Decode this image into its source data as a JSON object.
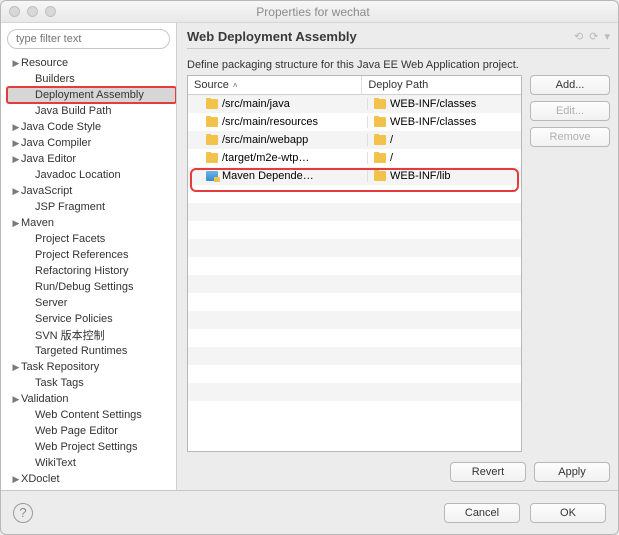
{
  "window": {
    "title": "Properties for wechat"
  },
  "filter": {
    "placeholder": "type filter text"
  },
  "tree": [
    {
      "label": "Resource",
      "expandable": true,
      "indent": false
    },
    {
      "label": "Builders",
      "expandable": false,
      "indent": true
    },
    {
      "label": "Deployment Assembly",
      "expandable": false,
      "indent": true,
      "selected": true,
      "highlight": true
    },
    {
      "label": "Java Build Path",
      "expandable": false,
      "indent": true
    },
    {
      "label": "Java Code Style",
      "expandable": true,
      "indent": false
    },
    {
      "label": "Java Compiler",
      "expandable": true,
      "indent": false
    },
    {
      "label": "Java Editor",
      "expandable": true,
      "indent": false
    },
    {
      "label": "Javadoc Location",
      "expandable": false,
      "indent": true
    },
    {
      "label": "JavaScript",
      "expandable": true,
      "indent": false
    },
    {
      "label": "JSP Fragment",
      "expandable": false,
      "indent": true
    },
    {
      "label": "Maven",
      "expandable": true,
      "indent": false
    },
    {
      "label": "Project Facets",
      "expandable": false,
      "indent": true
    },
    {
      "label": "Project References",
      "expandable": false,
      "indent": true
    },
    {
      "label": "Refactoring History",
      "expandable": false,
      "indent": true
    },
    {
      "label": "Run/Debug Settings",
      "expandable": false,
      "indent": true
    },
    {
      "label": "Server",
      "expandable": false,
      "indent": true
    },
    {
      "label": "Service Policies",
      "expandable": false,
      "indent": true
    },
    {
      "label": "SVN 版本控制",
      "expandable": false,
      "indent": true
    },
    {
      "label": "Targeted Runtimes",
      "expandable": false,
      "indent": true
    },
    {
      "label": "Task Repository",
      "expandable": true,
      "indent": false
    },
    {
      "label": "Task Tags",
      "expandable": false,
      "indent": true
    },
    {
      "label": "Validation",
      "expandable": true,
      "indent": false
    },
    {
      "label": "Web Content Settings",
      "expandable": false,
      "indent": true
    },
    {
      "label": "Web Page Editor",
      "expandable": false,
      "indent": true
    },
    {
      "label": "Web Project Settings",
      "expandable": false,
      "indent": true
    },
    {
      "label": "WikiText",
      "expandable": false,
      "indent": true
    },
    {
      "label": "XDoclet",
      "expandable": true,
      "indent": false
    }
  ],
  "main": {
    "title": "Web Deployment Assembly",
    "description": "Define packaging structure for this Java EE Web Application project.",
    "columns": {
      "source": "Source",
      "deploy": "Deploy Path"
    },
    "rows": [
      {
        "source": "/src/main/java",
        "deploy": "WEB-INF/classes",
        "src_icon": "folder",
        "dep_icon": "folder"
      },
      {
        "source": "/src/main/resources",
        "deploy": "WEB-INF/classes",
        "src_icon": "folder",
        "dep_icon": "folder"
      },
      {
        "source": "/src/main/webapp",
        "deploy": "/",
        "src_icon": "folder",
        "dep_icon": "folder"
      },
      {
        "source": "/target/m2e-wtp…",
        "deploy": "/",
        "src_icon": "folder",
        "dep_icon": "folder"
      },
      {
        "source": "Maven Depende…",
        "deploy": "WEB-INF/lib",
        "src_icon": "lib",
        "dep_icon": "folder",
        "highlight": true
      }
    ],
    "buttons": {
      "add": "Add...",
      "edit": "Edit...",
      "remove": "Remove"
    },
    "footer": {
      "revert": "Revert",
      "apply": "Apply"
    }
  },
  "dialog_buttons": {
    "cancel": "Cancel",
    "ok": "OK"
  }
}
